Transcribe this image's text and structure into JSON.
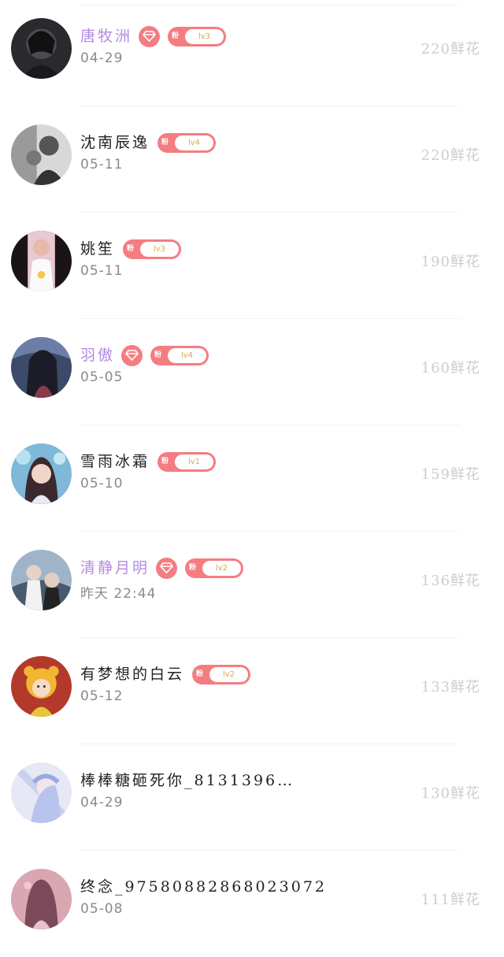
{
  "fan_badge_tag": "粉",
  "flower_unit": "鲜花",
  "colors": {
    "vip_name": "#b48be0",
    "badge": "#f47d81",
    "level_text": "#d4a94a",
    "flowers": "#cdcdcd"
  },
  "rows": [
    {
      "name": "唐牧洲",
      "vip": true,
      "level": "lv3",
      "date": "04-29",
      "flowers": "220",
      "avatar": "dark-hooded-figure"
    },
    {
      "name": "沈南辰逸",
      "vip": false,
      "level": "lv4",
      "date": "05-11",
      "flowers": "220",
      "avatar": "black-white-couple"
    },
    {
      "name": "姚笙",
      "vip": false,
      "level": "lv3",
      "date": "05-11",
      "flowers": "190",
      "avatar": "girl-white-shirt"
    },
    {
      "name": "羽傲",
      "vip": true,
      "level": "lv4",
      "date": "05-05",
      "flowers": "160",
      "avatar": "anime-warrior"
    },
    {
      "name": "雪雨冰霜",
      "vip": false,
      "level": "lv1",
      "date": "05-10",
      "flowers": "159",
      "avatar": "girl-blue-bg"
    },
    {
      "name": "清静月明",
      "vip": true,
      "level": "lv2",
      "date": "昨天 22:44",
      "flowers": "136",
      "avatar": "two-anime-men"
    },
    {
      "name": "有梦想的白云",
      "vip": false,
      "level": "lv2",
      "date": "05-12",
      "flowers": "133",
      "avatar": "cartoon-tiger-kid"
    },
    {
      "name": "棒棒糖砸死你_8131396…",
      "vip": false,
      "level": null,
      "date": "04-29",
      "flowers": "130",
      "avatar": "pastel-anime-girl"
    },
    {
      "name": "终念_97580882868023072",
      "vip": false,
      "level": null,
      "date": "05-08",
      "flowers": "111",
      "avatar": "pink-anime-girl"
    }
  ]
}
